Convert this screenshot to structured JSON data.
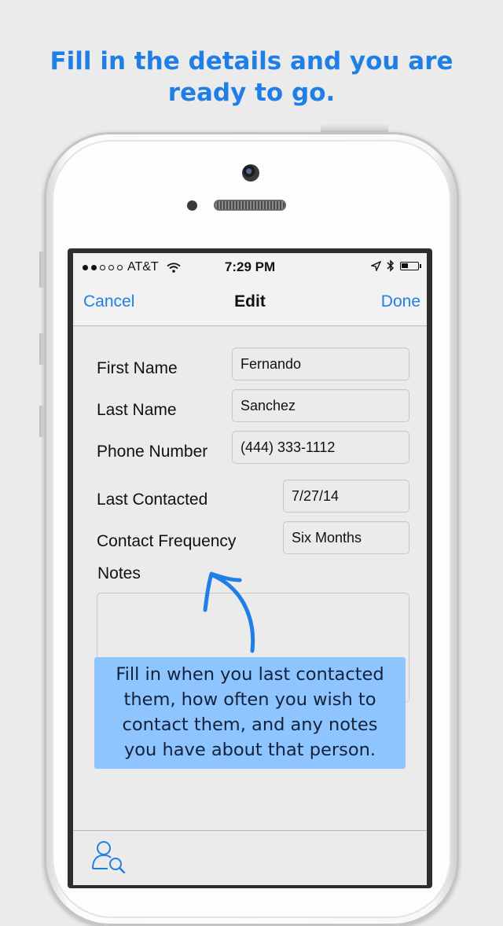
{
  "headline": {
    "line1": "Fill in the details and you are",
    "line2": "ready to go."
  },
  "status_bar": {
    "carrier": "AT&T",
    "time": "7:29 PM",
    "signal_dots_filled": 2,
    "signal_dots_total": 5
  },
  "nav": {
    "cancel_label": "Cancel",
    "title": "Edit",
    "done_label": "Done"
  },
  "form": {
    "first_name": {
      "label": "First Name",
      "value": "Fernando"
    },
    "last_name": {
      "label": "Last Name",
      "value": "Sanchez"
    },
    "phone": {
      "label": "Phone Number",
      "value": "(444) 333-1112"
    },
    "last_contacted": {
      "label": "Last Contacted",
      "value": "7/27/14"
    },
    "contact_frequency": {
      "label": "Contact Frequency",
      "value": "Six Months"
    },
    "notes": {
      "label": "Notes",
      "value": ""
    }
  },
  "callout": {
    "line1": "Fill in when you last contacted",
    "line2": "them, how often you wish to",
    "line3": "contact them, and any notes",
    "line4": "you have about that person."
  },
  "colors": {
    "accent": "#1f7fe6",
    "callout_bg": "#8ec5ff"
  },
  "icons": {
    "toolbar": "contact-search-icon"
  }
}
